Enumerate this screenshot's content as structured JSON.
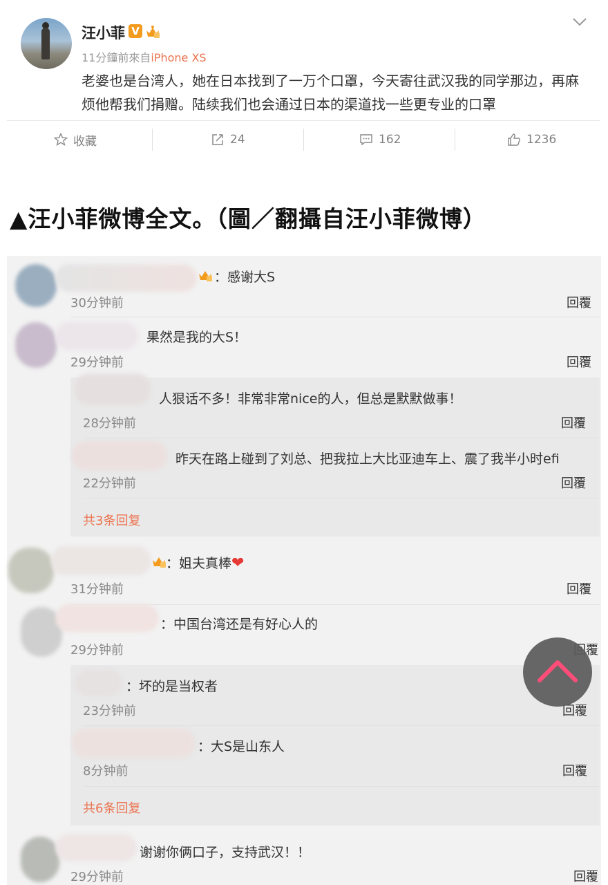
{
  "post": {
    "username": "汪小菲",
    "verified_badge": "V",
    "time_prefix": "11分鐘前來自",
    "device": "iPhone XS",
    "text": "老婆也是台湾人，她在日本找到了一万个口罩，今天寄往武汉我的同学那边，再麻烦他帮我们捐赠。陆续我们也会通过日本的渠道找一些更专业的口罩",
    "actions": {
      "favorite_label": "收藏",
      "repost_count": "24",
      "comment_count": "162",
      "like_count": "1236"
    }
  },
  "caption": "▲汪小菲微博全文。（圖／翻攝自汪小菲微博）",
  "comments": [
    {
      "text": "：感谢大S",
      "time": "30分钟前",
      "reply": "回覆"
    },
    {
      "text": "果然是我的大S！",
      "time": "29分钟前",
      "reply": "回覆",
      "replies": [
        {
          "text": "人狠话不多！非常非常nice的人，但总是默默做事！",
          "time": "28分钟前",
          "reply": "回覆"
        },
        {
          "text": "昨天在路上碰到了刘总、把我拉上大比亚迪车上、震了我半小时efi",
          "time": "22分钟前",
          "reply": "回覆"
        }
      ],
      "more": "共3条回复"
    },
    {
      "text": "：姐夫真棒",
      "time": "31分钟前",
      "reply": "回覆"
    },
    {
      "text": "：中国台湾还是有好心人的",
      "time": "29分钟前",
      "reply": "回覆",
      "replies": [
        {
          "text": "：坏的是当权者",
          "time": "23分钟前",
          "reply": "回覆"
        },
        {
          "text": "：大S是山东人",
          "time": "8分钟前",
          "reply": "回覆"
        }
      ],
      "more": "共6条回复"
    },
    {
      "text": "谢谢你俩口子，支持武汉！！",
      "time": "29分钟前",
      "reply": "回覆"
    }
  ],
  "colors": {
    "accent": "#eb7350",
    "badge": "#f39b1f",
    "heart": "#e53935"
  }
}
